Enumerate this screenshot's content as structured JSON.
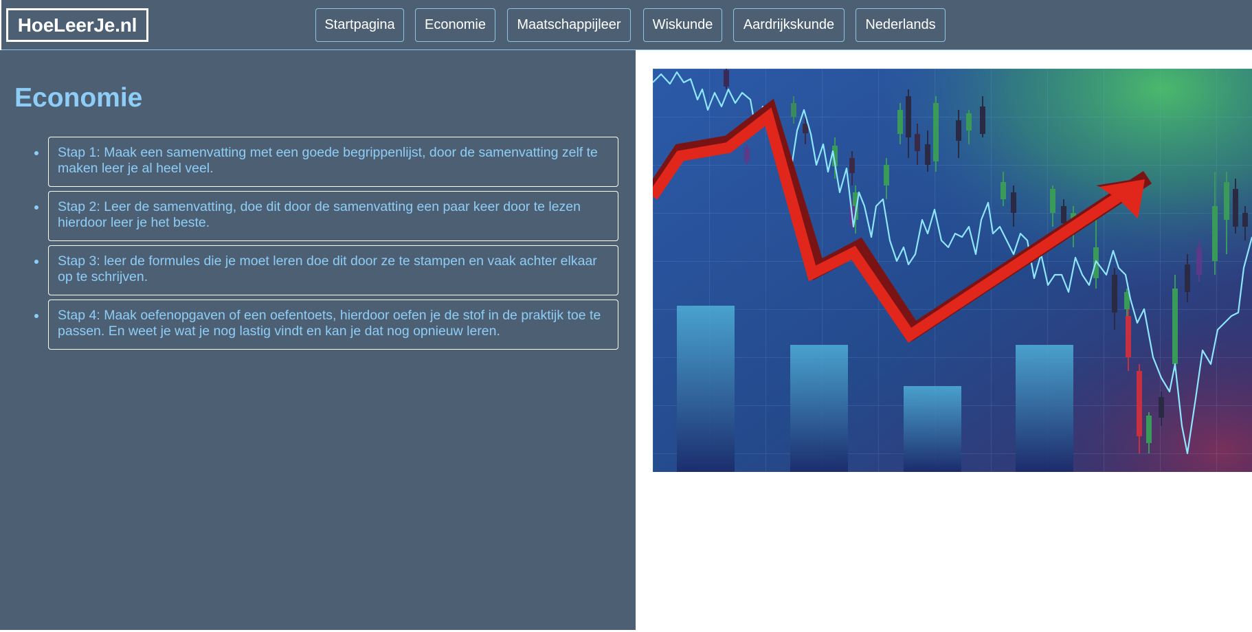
{
  "header": {
    "logo_text": "HoeLeerJe.nl",
    "nav": [
      {
        "label": "Startpagina"
      },
      {
        "label": "Economie"
      },
      {
        "label": "Maatschappijleer"
      },
      {
        "label": "Wiskunde"
      },
      {
        "label": "Aardrijkskunde"
      },
      {
        "label": "Nederlands"
      }
    ]
  },
  "main": {
    "title": "Economie",
    "steps": [
      {
        "text": "Stap 1: Maak een samenvatting met een goede begrippenlijst, door de samenvatting zelf te maken leer je al heel veel."
      },
      {
        "text": "Stap 2: Leer de samenvatting, doe dit door de samenvatting een paar keer door te lezen hierdoor leer je het beste."
      },
      {
        "text": "Stap 3: leer de formules die je moet leren doe dit door ze te stampen en vaak achter elkaar op te schrijven."
      },
      {
        "text": "Stap 4: Maak oefenopgaven of een oefentoets, hierdoor oefen je de stof in de praktijk toe te passen. En weet je wat je nog lastig vindt en kan je dat nog opnieuw leren."
      }
    ]
  },
  "colors": {
    "panel_bg": "#4d6073",
    "accent_text": "#8ecdf7",
    "border_light": "#8ec6e8",
    "arrow_red": "#e1261c"
  },
  "illustration": {
    "name": "stock-market-chart-illustration"
  }
}
